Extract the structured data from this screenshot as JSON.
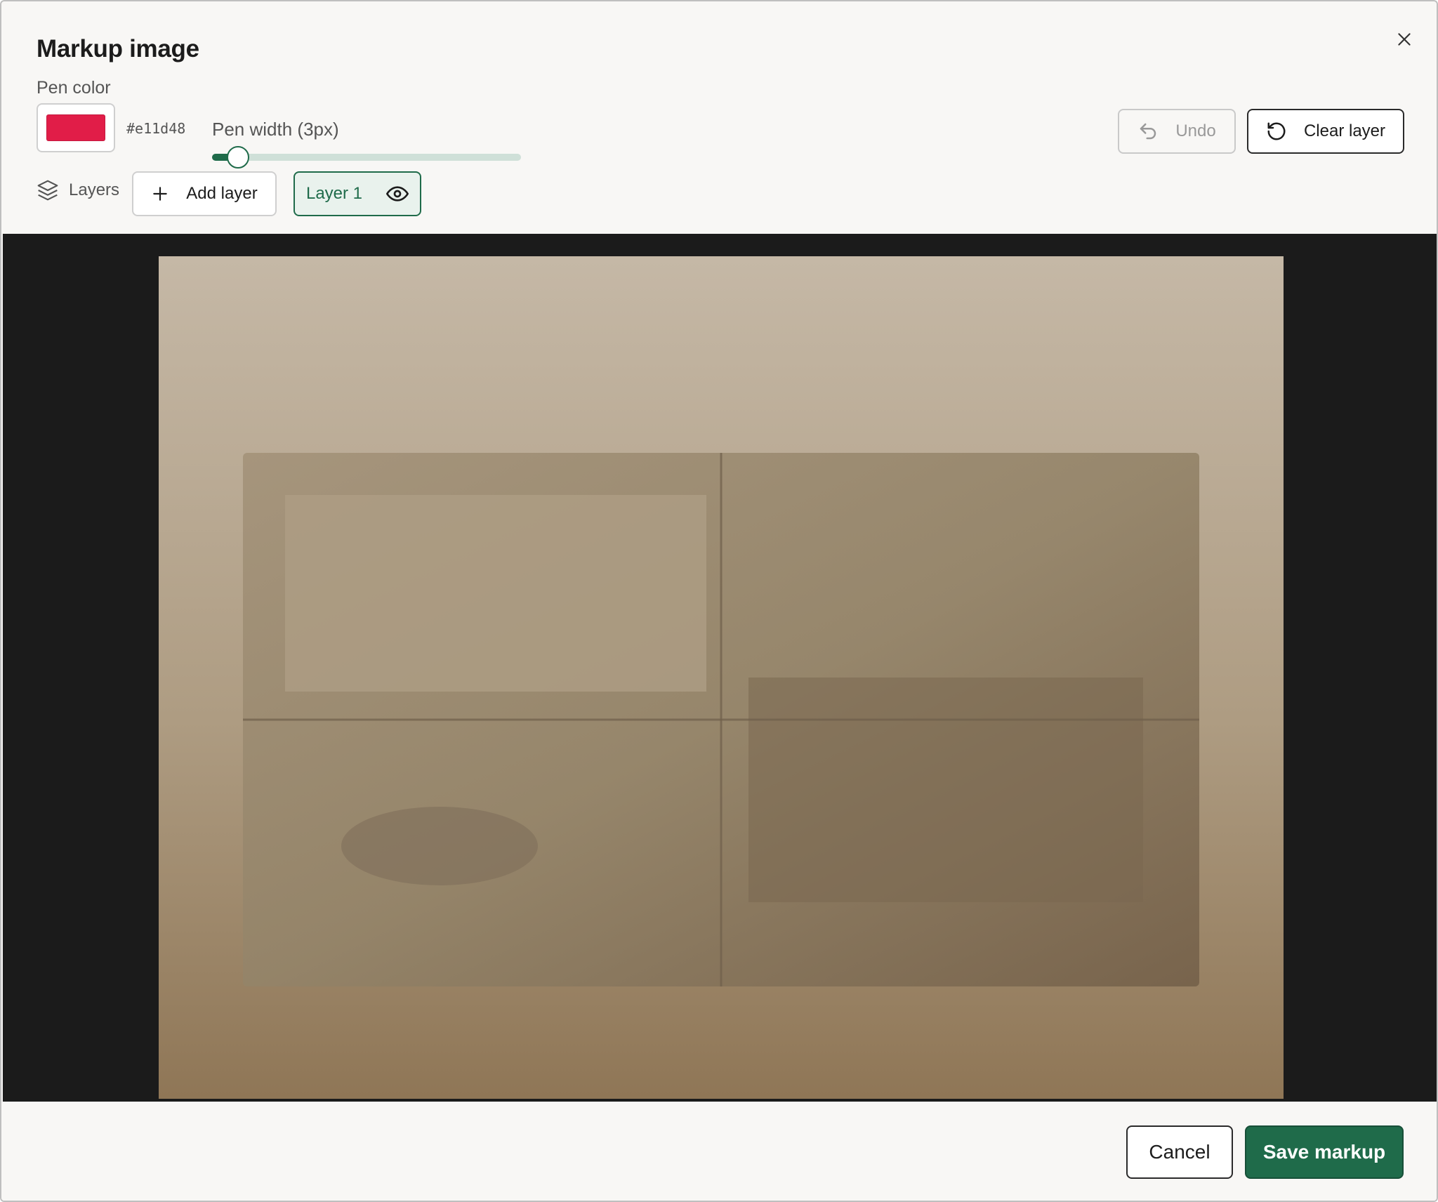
{
  "dialog": {
    "title": "Markup image",
    "close_icon": "close-icon"
  },
  "toolbar": {
    "pen_color_label": "Pen color",
    "pen_color_hex": "#e11d48",
    "pen_width_label": "Pen width (3px)",
    "pen_width": {
      "min": 1,
      "max": 30,
      "value": 3
    },
    "undo_label": "Undo",
    "undo_icon": "undo-icon",
    "clear_label": "Clear layer",
    "clear_icon": "rotate-ccw-icon"
  },
  "layers": {
    "label": "Layers",
    "icon": "layers-icon",
    "add_label": "Add layer",
    "add_icon": "plus-icon",
    "items": [
      {
        "label": "Layer 1",
        "visible": true,
        "active": true,
        "icon": "eye-icon"
      }
    ]
  },
  "footer": {
    "cancel_label": "Cancel",
    "save_label": "Save markup"
  },
  "colors": {
    "accent": "#1f6b4a",
    "pen": "#e11d48",
    "canvas_bg": "#1b1b1b"
  }
}
